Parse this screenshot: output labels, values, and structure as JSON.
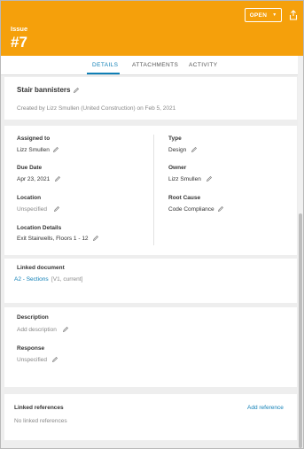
{
  "header": {
    "issue_label": "Issue",
    "issue_number": "#7",
    "status": "OPEN",
    "colors": {
      "header_bg": "#f5a00b",
      "accent": "#0f7fb6"
    }
  },
  "tabs": [
    {
      "label": "DETAILS",
      "active": true
    },
    {
      "label": "ATTACHMENTS",
      "active": false
    },
    {
      "label": "ACTIVITY",
      "active": false
    }
  ],
  "summary": {
    "title": "Stair bannisters",
    "created": "Created by Lizz Smullen (United Construction) on Feb 5, 2021"
  },
  "fields": {
    "assigned_to": {
      "label": "Assigned to",
      "value": "Lizz Smullen"
    },
    "due_date": {
      "label": "Due Date",
      "value": "Apr 23, 2021"
    },
    "location": {
      "label": "Location",
      "value": "Unspecified"
    },
    "location_details": {
      "label": "Location Details",
      "value": "Exit Stairwells, Floors 1 - 12"
    },
    "type": {
      "label": "Type",
      "value": "Design"
    },
    "owner": {
      "label": "Owner",
      "value": "Lizz Smullen"
    },
    "root_cause": {
      "label": "Root Cause",
      "value": "Code Compliance"
    }
  },
  "linked_document": {
    "label": "Linked document",
    "name": "A2 - Sections",
    "version": "[V1, current]"
  },
  "description": {
    "label": "Description",
    "placeholder": "Add description"
  },
  "response": {
    "label": "Response",
    "value": "Unspecified"
  },
  "linked_references": {
    "label": "Linked references",
    "add_label": "Add reference",
    "empty_text": "No linked references"
  },
  "icons": {
    "status_chevron": "chevron-down-icon",
    "share": "share-icon",
    "edit": "pencil-icon"
  }
}
